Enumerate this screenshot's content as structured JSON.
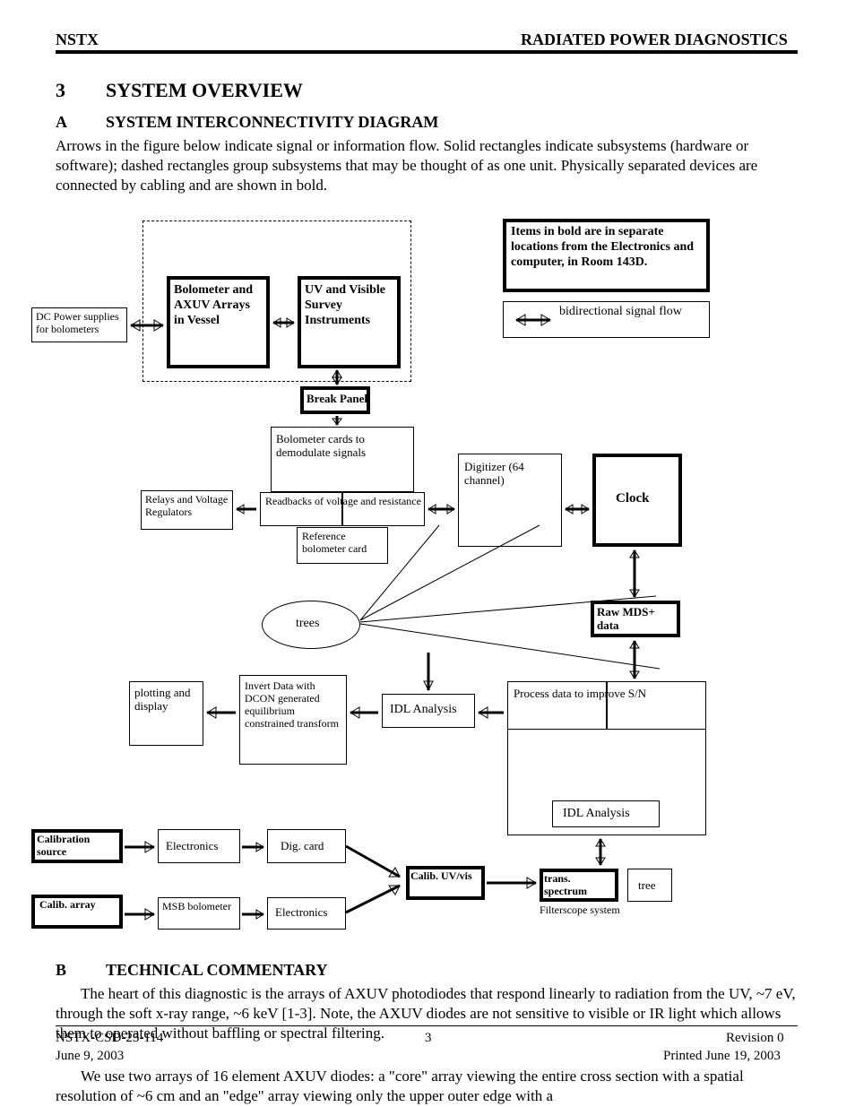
{
  "header": {
    "left": "NSTX",
    "right": "RADIATED POWER DIAGNOSTICS"
  },
  "section": {
    "number": "3",
    "title": "SYSTEM OVERVIEW"
  },
  "figure": {
    "letter": "A",
    "title": "SYSTEM INTERCONNECTIVITY DIAGRAM",
    "caption": "Arrows in the figure below indicate signal or information flow. Solid rectangles indicate subsystems (hardware or software); dashed rectangles group subsystems that may be thought of as one unit. Physically separated devices are connected by cabling and are shown in bold."
  },
  "legend": {
    "bold_note": "Items in bold are in separate locations from the Electronics and computer, in Room 143D.",
    "arrow_label": "bidirectional signal flow"
  },
  "nodes": {
    "dc_power": "DC Power supplies for bolometers",
    "bolometer_array": "Bolometer and AXUV Arrays in Vessel",
    "uv_vis": "UV and Visible Survey Instruments",
    "break_panel": "Break Panel",
    "demod_cards": "Bolometer cards to demodulate signals",
    "relay_regs": "Relays and Voltage Regulators",
    "readbacks": "Readbacks of voltage and resistance",
    "ref_bolometer": "Reference bolometer card",
    "digitizer": "Digitizer (64 channel)",
    "clock": "Clock",
    "raw_data": "Raw MDS+ data",
    "idl_analysis": "IDL Analysis",
    "process_data": "Process data to improve S/N",
    "trees": "trees",
    "invert_data": "Invert Data with DCON generated equilibrium constrained transform",
    "plotting": "plotting and display",
    "calib_source": "Calibration source",
    "electronics": "Electronics",
    "dig_card": "Dig. card",
    "calib_array": "Calib. array",
    "msb_bolo": "MSB bolometer",
    "calib_uvvis": "Calib. UV/vis",
    "trans_spec": "trans. spectrum",
    "tree": "tree",
    "filter_sys": "Filterscope system"
  },
  "commentary": {
    "letter": "B",
    "title": "TECHNICAL COMMENTARY",
    "p1": "The heart of this diagnostic is the arrays of AXUV photodiodes that respond linearly to radiation from the UV, ~7 eV, through the soft x-ray range, ~6 keV [1-3]. Note, the AXUV diodes are not sensitive to visible or IR light which allows them to operated without baffling or spectral filtering.",
    "p2": "We use two arrays of 16 element AXUV diodes: a \"core\" array viewing the entire cross section with a spatial resolution of ~6 cm and an \"edge\" array viewing only the upper outer edge with a"
  },
  "footer": {
    "doc_no": "NSTX-CSD-23-114",
    "page": "3",
    "rev": "Revision 0",
    "date": "June 9, 2003",
    "print_note": "Printed June 19, 2003"
  }
}
